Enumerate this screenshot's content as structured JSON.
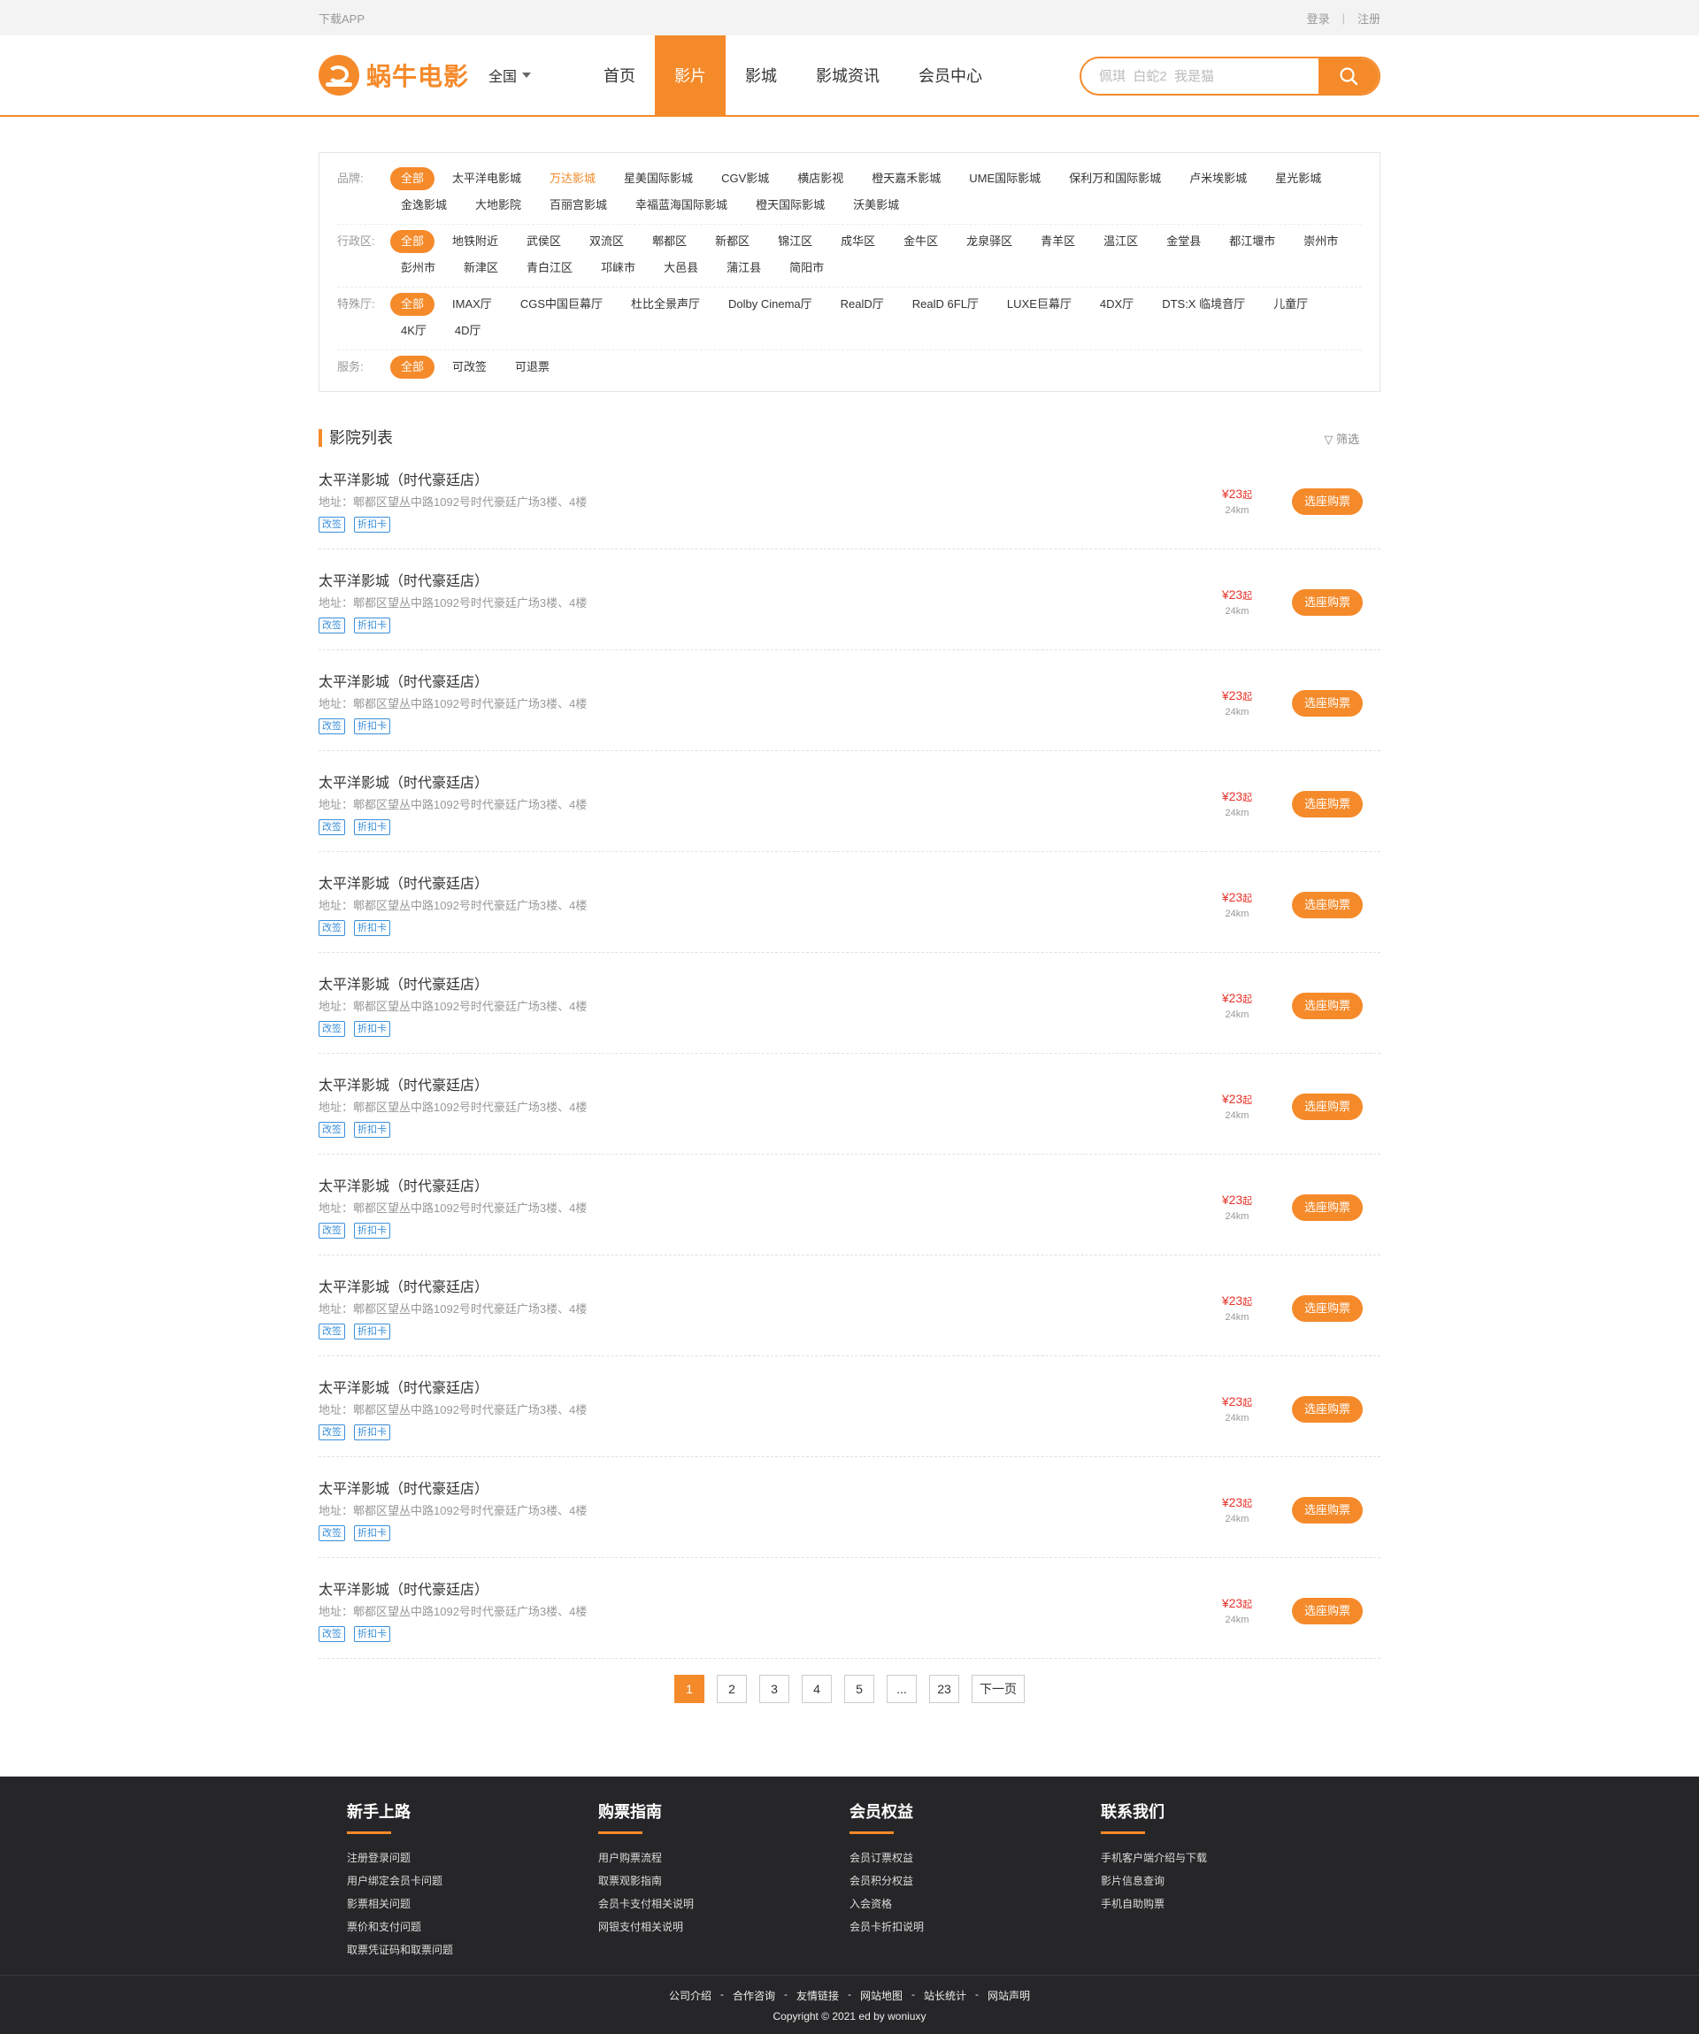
{
  "topbar": {
    "app": "下载APP",
    "login": "登录",
    "sep": "|",
    "register": "注册"
  },
  "header": {
    "logo_text": "蜗牛电影",
    "city": "全国",
    "nav": [
      "首页",
      "影片",
      "影城",
      "影城资讯",
      "会员中心"
    ],
    "active_nav": 1,
    "search_placeholder": "佩琪  白蛇2  我是猫"
  },
  "filters": [
    {
      "label": "品牌:",
      "options": [
        "全部",
        "太平洋电影城",
        "万达影城",
        "星美国际影城",
        "CGV影城",
        "横店影视",
        "橙天嘉禾影城",
        "UME国际影城",
        "保利万和国际影城",
        "卢米埃影城",
        "星光影城",
        "金逸影城",
        "大地影院",
        "百丽宫影城",
        "幸福蓝海国际影城",
        "橙天国际影城",
        "沃美影城"
      ],
      "on": 0,
      "hl": 2
    },
    {
      "label": "行政区:",
      "options": [
        "全部",
        "地铁附近",
        "武侯区",
        "双流区",
        "郫都区",
        "新都区",
        "锦江区",
        "成华区",
        "金牛区",
        "龙泉驿区",
        "青羊区",
        "温江区",
        "金堂县",
        "都江堰市",
        "崇州市",
        "彭州市",
        "新津区",
        "青白江区",
        "邛崃市",
        "大邑县",
        "蒲江县",
        "简阳市"
      ],
      "on": 0,
      "hl": -1
    },
    {
      "label": "特殊厅:",
      "options": [
        "全部",
        "IMAX厅",
        "CGS中国巨幕厅",
        "杜比全景声厅",
        "Dolby Cinema厅",
        "RealD厅",
        "RealD 6FL厅",
        "LUXE巨幕厅",
        "4DX厅",
        "DTS:X 临境音厅",
        "儿童厅",
        "4K厅",
        "4D厅"
      ],
      "on": 0,
      "hl": -1
    },
    {
      "label": "服务:",
      "options": [
        "全部",
        "可改签",
        "可退票"
      ],
      "on": 0,
      "hl": -1
    }
  ],
  "list": {
    "title": "影院列表",
    "filter_label": "筛选",
    "cinemas": [
      {
        "name": "太平洋影城（时代豪廷店）",
        "addr": "地址：郫都区望丛中路1092号时代豪廷广场3楼、4楼",
        "tags": [
          "改签",
          "折扣卡"
        ],
        "price": "¥23",
        "price_suffix": "起",
        "distance": "24km",
        "button": "选座购票"
      },
      {
        "name": "太平洋影城（时代豪廷店）",
        "addr": "地址：郫都区望丛中路1092号时代豪廷广场3楼、4楼",
        "tags": [
          "改签",
          "折扣卡"
        ],
        "price": "¥23",
        "price_suffix": "起",
        "distance": "24km",
        "button": "选座购票"
      },
      {
        "name": "太平洋影城（时代豪廷店）",
        "addr": "地址：郫都区望丛中路1092号时代豪廷广场3楼、4楼",
        "tags": [
          "改签",
          "折扣卡"
        ],
        "price": "¥23",
        "price_suffix": "起",
        "distance": "24km",
        "button": "选座购票"
      },
      {
        "name": "太平洋影城（时代豪廷店）",
        "addr": "地址：郫都区望丛中路1092号时代豪廷广场3楼、4楼",
        "tags": [
          "改签",
          "折扣卡"
        ],
        "price": "¥23",
        "price_suffix": "起",
        "distance": "24km",
        "button": "选座购票"
      },
      {
        "name": "太平洋影城（时代豪廷店）",
        "addr": "地址：郫都区望丛中路1092号时代豪廷广场3楼、4楼",
        "tags": [
          "改签",
          "折扣卡"
        ],
        "price": "¥23",
        "price_suffix": "起",
        "distance": "24km",
        "button": "选座购票"
      },
      {
        "name": "太平洋影城（时代豪廷店）",
        "addr": "地址：郫都区望丛中路1092号时代豪廷广场3楼、4楼",
        "tags": [
          "改签",
          "折扣卡"
        ],
        "price": "¥23",
        "price_suffix": "起",
        "distance": "24km",
        "button": "选座购票"
      },
      {
        "name": "太平洋影城（时代豪廷店）",
        "addr": "地址：郫都区望丛中路1092号时代豪廷广场3楼、4楼",
        "tags": [
          "改签",
          "折扣卡"
        ],
        "price": "¥23",
        "price_suffix": "起",
        "distance": "24km",
        "button": "选座购票"
      },
      {
        "name": "太平洋影城（时代豪廷店）",
        "addr": "地址：郫都区望丛中路1092号时代豪廷广场3楼、4楼",
        "tags": [
          "改签",
          "折扣卡"
        ],
        "price": "¥23",
        "price_suffix": "起",
        "distance": "24km",
        "button": "选座购票"
      },
      {
        "name": "太平洋影城（时代豪廷店）",
        "addr": "地址：郫都区望丛中路1092号时代豪廷广场3楼、4楼",
        "tags": [
          "改签",
          "折扣卡"
        ],
        "price": "¥23",
        "price_suffix": "起",
        "distance": "24km",
        "button": "选座购票"
      },
      {
        "name": "太平洋影城（时代豪廷店）",
        "addr": "地址：郫都区望丛中路1092号时代豪廷广场3楼、4楼",
        "tags": [
          "改签",
          "折扣卡"
        ],
        "price": "¥23",
        "price_suffix": "起",
        "distance": "24km",
        "button": "选座购票"
      },
      {
        "name": "太平洋影城（时代豪廷店）",
        "addr": "地址：郫都区望丛中路1092号时代豪廷广场3楼、4楼",
        "tags": [
          "改签",
          "折扣卡"
        ],
        "price": "¥23",
        "price_suffix": "起",
        "distance": "24km",
        "button": "选座购票"
      },
      {
        "name": "太平洋影城（时代豪廷店）",
        "addr": "地址：郫都区望丛中路1092号时代豪廷广场3楼、4楼",
        "tags": [
          "改签",
          "折扣卡"
        ],
        "price": "¥23",
        "price_suffix": "起",
        "distance": "24km",
        "button": "选座购票"
      }
    ]
  },
  "pagination": {
    "pages": [
      "1",
      "2",
      "3",
      "4",
      "5",
      "...",
      "23",
      "下一页"
    ],
    "current": 0
  },
  "footer": {
    "columns": [
      {
        "title": "新手上路",
        "links": [
          "注册登录问题",
          "用户绑定会员卡问题",
          "影票相关问题",
          "票价和支付问题",
          "取票凭证码和取票问题"
        ]
      },
      {
        "title": "购票指南",
        "links": [
          "用户购票流程",
          "取票观影指南",
          "会员卡支付相关说明",
          "网银支付相关说明"
        ]
      },
      {
        "title": "会员权益",
        "links": [
          "会员订票权益",
          "会员积分权益",
          "入会资格",
          "会员卡折扣说明"
        ]
      },
      {
        "title": "联系我们",
        "links": [
          "手机客户端介绍与下载",
          "影片信息查询",
          "手机自助购票"
        ]
      }
    ],
    "bottom_links": [
      "公司介绍",
      "合作咨询",
      "友情链接",
      "网站地图",
      "站长统计",
      "网站声明"
    ],
    "copyright": "Copyright © 2021 ed by woniuxy"
  },
  "colors": {
    "accent": "#f58a2a",
    "price": "#e8342b",
    "tag": "#3a8fd9",
    "footer_bg": "#262628"
  }
}
